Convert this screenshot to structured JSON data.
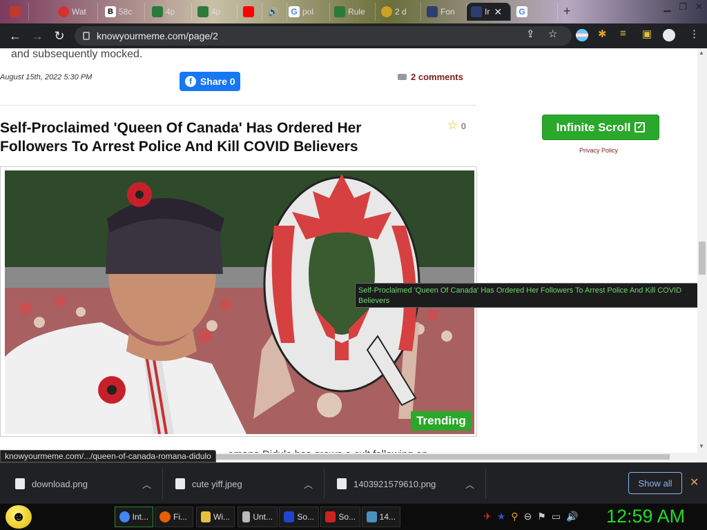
{
  "browser": {
    "tabs": [
      {
        "label": "",
        "fav_color": "#c0392b"
      },
      {
        "label": "Wat",
        "fav_color": "#d63031"
      },
      {
        "label": "58c",
        "fav_color": "#333333"
      },
      {
        "label": "4p",
        "fav_color": "#2a7a3a"
      },
      {
        "label": "4p",
        "fav_color": "#2a7a3a"
      },
      {
        "label": "",
        "fav_color": "#ff0000"
      },
      {
        "label": "",
        "fav_color": "#888888"
      },
      {
        "label": "pol",
        "fav_color": "#4285f4"
      },
      {
        "label": "Rule",
        "fav_color": "#2a7a3a"
      },
      {
        "label": "2 d",
        "fav_color": "#c9a227"
      },
      {
        "label": "Fon",
        "fav_color": "#2c3e70"
      },
      {
        "label": "Ir",
        "fav_color": "#2c3e70",
        "active": true
      },
      {
        "label": "",
        "fav_color": "#4285f4"
      }
    ],
    "new_tab": "+",
    "url": "knowyourmeme.com/page/2",
    "status_url": "knowyourmeme.com/.../queen-of-canada-romana-didulo"
  },
  "page": {
    "prev_text": "and subsequently mocked.",
    "post_date": "August 15th, 2022 5:30 PM",
    "share_label": "Share 0",
    "comments_label": "2 comments",
    "headline": "Self-Proclaimed 'Queen Of Canada' Has Ordered Her Followers To Arrest Police And Kill COVID Believers",
    "favorites_count": "0",
    "infinite_scroll_label": "Infinite Scroll",
    "privacy_label": "Privacy Policy",
    "trending_label": "Trending",
    "tooltip": "Self-Proclaimed 'Queen Of Canada' Has Ordered Her Followers To Arrest Police And Kill COVID Believers",
    "below_text": "omana Didulo has grown a cult following on"
  },
  "downloads": {
    "items": [
      "download.png",
      "cute yiff.jpeg",
      "1403921579610.png"
    ],
    "show_all": "Show all"
  },
  "taskbar": {
    "tasks": [
      {
        "label": "Int...",
        "color": "#4285f4",
        "active": true
      },
      {
        "label": "Fi...",
        "color": "#e66000"
      },
      {
        "label": "Wi...",
        "color": "#e8c040"
      },
      {
        "label": "Unt...",
        "color": "#bbbbbb"
      },
      {
        "label": "So...",
        "color": "#2244cc"
      },
      {
        "label": "So...",
        "color": "#cc2222"
      },
      {
        "label": "14...",
        "color": "#4a90c0"
      }
    ],
    "clock": "12:59 AM"
  }
}
